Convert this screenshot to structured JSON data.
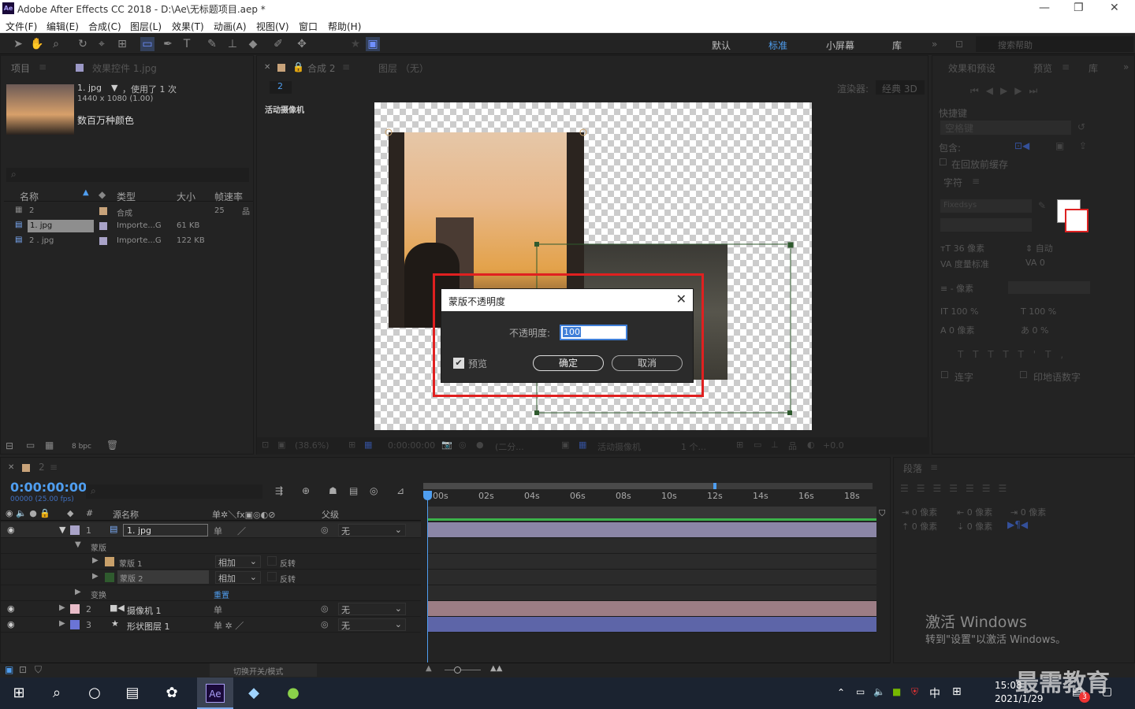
{
  "titlebar": {
    "title": "Adobe After Effects CC 2018 - D:\\Ae\\无标题项目.aep *",
    "logo": "Ae"
  },
  "menu": [
    "文件(F)",
    "编辑(E)",
    "合成(C)",
    "图层(L)",
    "效果(T)",
    "动画(A)",
    "视图(V)",
    "窗口",
    "帮助(H)"
  ],
  "workspaces": [
    "默认",
    "标准",
    "小屏幕",
    "库"
  ],
  "search_placeholder": "搜索帮助",
  "project": {
    "tab": "项目",
    "effects_tab": "效果控件 1.jpg",
    "file_name": "1. jpg",
    "usage": "，使用了 1 次",
    "dims": "1440 x 1080 (1.00)",
    "colors": "数百万种颜色",
    "columns": [
      "名称",
      "类型",
      "大小",
      "帧速率"
    ],
    "rows": [
      {
        "name": "2",
        "type": "合成",
        "size": "",
        "fps": "25"
      },
      {
        "name": "1. jpg",
        "type": "Importe...G",
        "size": "61 KB",
        "fps": ""
      },
      {
        "name": "2 . jpg",
        "type": "Importe...G",
        "size": "122 KB",
        "fps": ""
      }
    ],
    "bpc": "8 bpc"
  },
  "viewer": {
    "comp_tab": "合成 2",
    "layer_tab": "图层 （无）",
    "comp_name": "2",
    "renderer_label": "渲染器:",
    "renderer_value": "经典 3D",
    "active_camera_label": "活动摄像机",
    "footer": {
      "zoom": "(38.6%)",
      "time": "0:00:00:00",
      "res": "(二分...",
      "camera": "活动摄像机",
      "views": "1 个...",
      "exposure": "+0.0"
    }
  },
  "dialog": {
    "title": "蒙版不透明度",
    "opacity_label": "不透明度:",
    "opacity_value": "100",
    "preview_label": "预览",
    "ok": "确定",
    "cancel": "取消"
  },
  "right_panel": {
    "tabs": [
      "效果和预设",
      "预览",
      "库"
    ],
    "shortcut_label": "快捷键",
    "shortcut_value": "空格键",
    "include_label": "包含:",
    "cache_label": "在回放前缓存",
    "char_tab": "字符",
    "font": "Fixedsys",
    "font_size": "36 像素",
    "leading": "自动",
    "kerning": "度量标准",
    "tracking": "0",
    "stroke": "- 像素",
    "vscale": "100 %",
    "hscale": "100 %",
    "baseline": "0 像素",
    "tsume": "0 %",
    "ligature": "连字",
    "hindi": "印地语数字",
    "para_tab": "段落",
    "para_values": [
      "0 像素",
      "0 像素",
      "0 像素",
      "0 像素",
      "0 像素"
    ],
    "watermark_title": "激活 Windows",
    "watermark_sub": "转到\"设置\"以激活 Windows。"
  },
  "timeline": {
    "comp_tab": "2",
    "timecode": "0:00:00:00",
    "timecode_sub": "00000 (25.00 fps)",
    "col_source": "源名称",
    "col_parent": "父级",
    "ruler": [
      "00s",
      "02s",
      "04s",
      "06s",
      "08s",
      "10s",
      "12s",
      "14s",
      "16s",
      "18s"
    ],
    "layers": [
      {
        "num": "1",
        "name": "1. jpg",
        "parent": "无",
        "color": "#a9a3c8"
      },
      {
        "num": "2",
        "name": "摄像机 1",
        "parent": "无",
        "color": "#e8bcc8"
      },
      {
        "num": "3",
        "name": "形状图层 1",
        "parent": "无",
        "color": "#6b74d6"
      }
    ],
    "mask_group": "蒙版",
    "masks": [
      {
        "name": "蒙版 1",
        "mode": "相加",
        "invert": "反转",
        "color": "#c8a06a"
      },
      {
        "name": "蒙版 2",
        "mode": "相加",
        "invert": "反转",
        "color": "#2f5a2e"
      }
    ],
    "transform": "变换",
    "reset": "重置",
    "footer": "切换开关/模式"
  },
  "taskbar": {
    "time": "15:08",
    "date": "2021/1/29",
    "ime": "中",
    "badge": "3",
    "watermark": "最需教育"
  }
}
